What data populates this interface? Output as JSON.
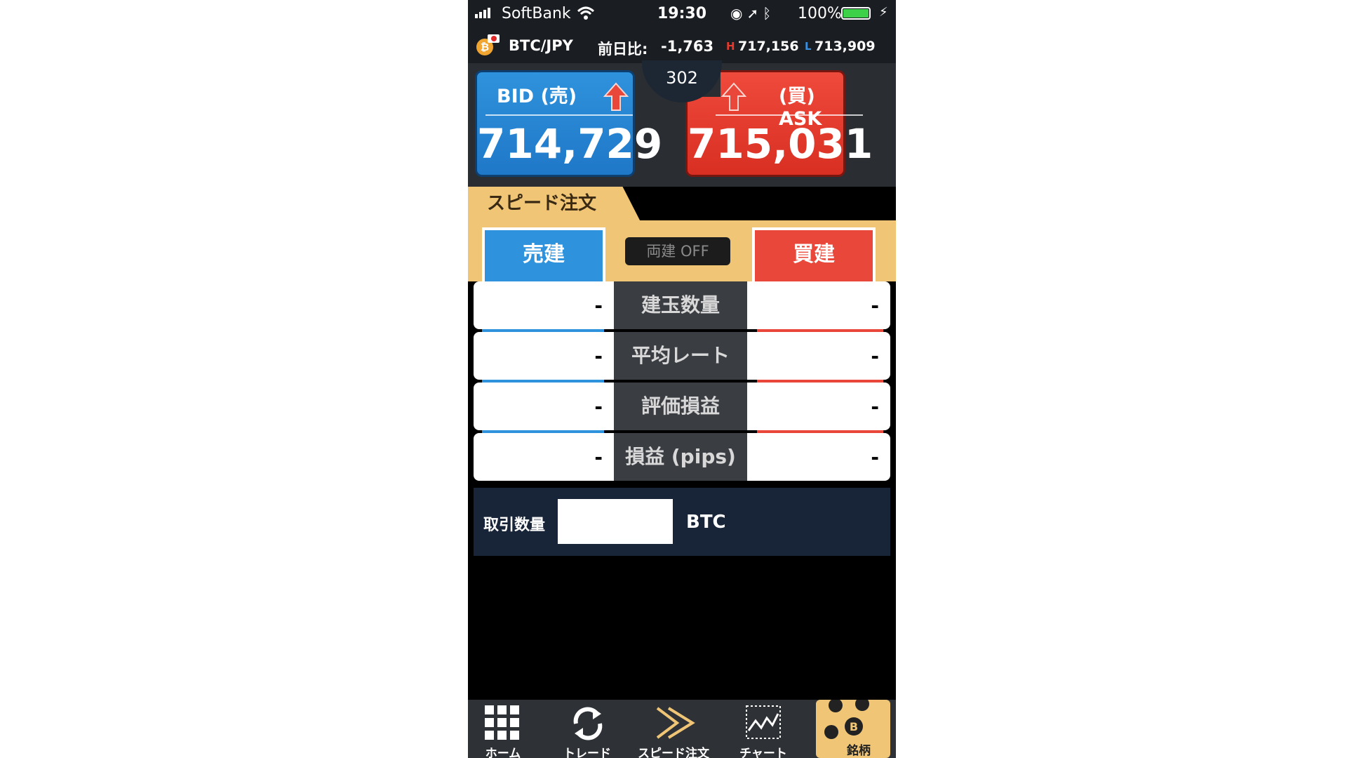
{
  "status_bar": {
    "carrier": "SoftBank",
    "time": "19:30",
    "battery_percent": "100%",
    "battery_level": 1.0
  },
  "ticker": {
    "pair": "BTC/JPY",
    "change_label": "前日比:",
    "change_value": "-1,763",
    "high_mark": "H",
    "high_value": "717,156",
    "low_mark": "L",
    "low_value": "713,909"
  },
  "quote": {
    "bid_label": "BID (売)",
    "bid_value": "714,729",
    "ask_label": "(買) ASK",
    "ask_value": "715,031",
    "spread": "302",
    "colors": {
      "bid": "#2f92dc",
      "ask": "#e8473a",
      "up_arrow": "#e8473a"
    }
  },
  "speed_order": {
    "title": "スピード注文",
    "sell_button": "売建",
    "buy_button": "買建",
    "both_toggle": "両建 OFF"
  },
  "positions": [
    {
      "label": "建玉数量",
      "sell": "-",
      "buy": "-"
    },
    {
      "label": "平均レート",
      "sell": "-",
      "buy": "-"
    },
    {
      "label": "評価損益",
      "sell": "-",
      "buy": "-"
    },
    {
      "label": "損益 (pips)",
      "sell": "-",
      "buy": "-"
    }
  ],
  "trade_qty": {
    "label": "取引数量",
    "value": "",
    "unit": "BTC"
  },
  "tabs": [
    {
      "label": "ホーム",
      "icon": "grid-icon"
    },
    {
      "label": "トレード",
      "icon": "refresh-icon"
    },
    {
      "label": "スピード注文",
      "icon": "double-chevron-icon"
    },
    {
      "label": "チャート",
      "icon": "chart-icon"
    },
    {
      "label": "銘柄",
      "icon": "coins-icon",
      "active": true
    }
  ],
  "theme": {
    "accent_gold": "#f0c676",
    "panel_dark": "#182538"
  }
}
